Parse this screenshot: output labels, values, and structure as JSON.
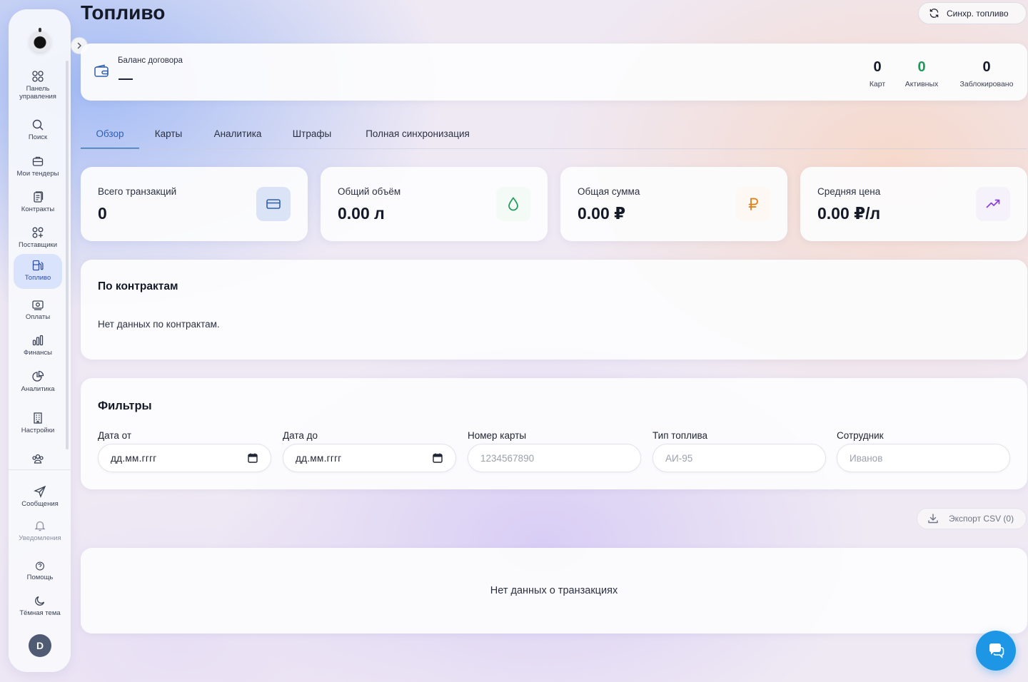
{
  "page": {
    "title": "Топливо"
  },
  "header": {
    "sync_button": "Синхр. топливо"
  },
  "sidebar": {
    "items": [
      {
        "label": "Панель управления",
        "icon": "dashboard-icon"
      },
      {
        "label": "Поиск",
        "icon": "search-icon"
      },
      {
        "label": "Мои тендеры",
        "icon": "briefcase-icon"
      },
      {
        "label": "Контракты",
        "icon": "documents-icon"
      },
      {
        "label": "Поставщики",
        "icon": "suppliers-icon"
      },
      {
        "label": "Топливо",
        "icon": "fuel-icon",
        "active": true
      },
      {
        "label": "Оплаты",
        "icon": "payment-icon"
      },
      {
        "label": "Финансы",
        "icon": "bar-chart-icon"
      },
      {
        "label": "Аналитика",
        "icon": "pie-chart-icon"
      },
      {
        "label": "Настройки",
        "icon": "building-icon"
      }
    ],
    "bottom": [
      {
        "label": "Сообщения",
        "icon": "send-icon"
      },
      {
        "label": "Уведомления",
        "icon": "bell-icon"
      },
      {
        "label": "Помощь",
        "icon": "help-icon"
      },
      {
        "label": "Тёмная тема",
        "icon": "moon-icon"
      }
    ],
    "avatar": "D"
  },
  "balance": {
    "label": "Баланс договора",
    "stats": [
      {
        "value": "0",
        "label": "Карт"
      },
      {
        "value": "0",
        "label": "Активных"
      },
      {
        "value": "0",
        "label": "Заблокировано"
      }
    ]
  },
  "tabs": [
    "Обзор",
    "Карты",
    "Аналитика",
    "Штрафы",
    "Полная синхронизация"
  ],
  "metrics": [
    {
      "label": "Всего транзакций",
      "value": "0",
      "icon": "credit-card-icon"
    },
    {
      "label": "Общий объём",
      "value": "0.00 л",
      "icon": "droplet-icon"
    },
    {
      "label": "Общая сумма",
      "value": "0.00 ₽",
      "icon": "ruble-icon"
    },
    {
      "label": "Средняя цена",
      "value": "0.00 ₽/л",
      "icon": "trending-up-icon"
    }
  ],
  "contracts": {
    "title": "По контрактам",
    "empty": "Нет данных по контрактам."
  },
  "filters": {
    "title": "Фильтры",
    "fields": [
      {
        "label": "Дата от",
        "value": "дд.мм.гггг"
      },
      {
        "label": "Дата до",
        "value": "дд.мм.гггг"
      },
      {
        "label": "Номер карты",
        "placeholder": "1234567890"
      },
      {
        "label": "Тип топлива",
        "placeholder": "АИ-95"
      },
      {
        "label": "Сотрудник",
        "placeholder": "Иванов"
      }
    ]
  },
  "export": {
    "label": "Экспорт CSV (0)"
  },
  "transactions": {
    "empty": "Нет данных о транзакциях"
  },
  "colors": {
    "accent": "#2f5fb0",
    "green": "#1f9a5a",
    "orange": "#e07b10",
    "purple": "#8a3fd6",
    "chat": "#1e96e6"
  }
}
